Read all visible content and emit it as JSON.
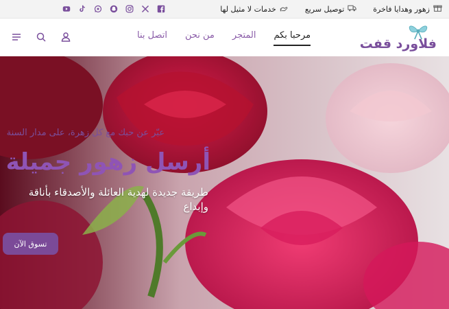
{
  "colors": {
    "brand_purple": "#8f54b5",
    "nav_purple": "#8a5ca8",
    "cta": "#7b4a98",
    "icon_purple": "#7a4f9c"
  },
  "topbar": {
    "features": [
      {
        "label": "زهور وهدايا فاخرة",
        "icon": "gift-icon"
      },
      {
        "label": "توصيل سريع",
        "icon": "truck-icon"
      },
      {
        "label": "خدمات لا مثيل لها",
        "icon": "service-icon"
      }
    ],
    "socials": [
      "youtube-icon",
      "tiktok-icon",
      "whatsapp-icon",
      "snapchat-icon",
      "instagram-icon",
      "x-icon",
      "facebook-icon"
    ]
  },
  "header": {
    "logo_text": "فلاورد قفت",
    "nav": [
      "مرحبا بكم",
      "المتجر",
      "من نحن",
      "اتصل بنا"
    ],
    "icons": [
      "account-icon",
      "search-icon",
      "menu-icon"
    ]
  },
  "hero": {
    "tagline": "عبّر عن حبك مع كل زهرة، على مدار السنة",
    "title": "أرسل زهور جميلة",
    "subtitle": "طريقة جديدة لهدية العائلة والأصدقاء بأناقة وإبداع",
    "cta_label": "تسوق الآن"
  }
}
